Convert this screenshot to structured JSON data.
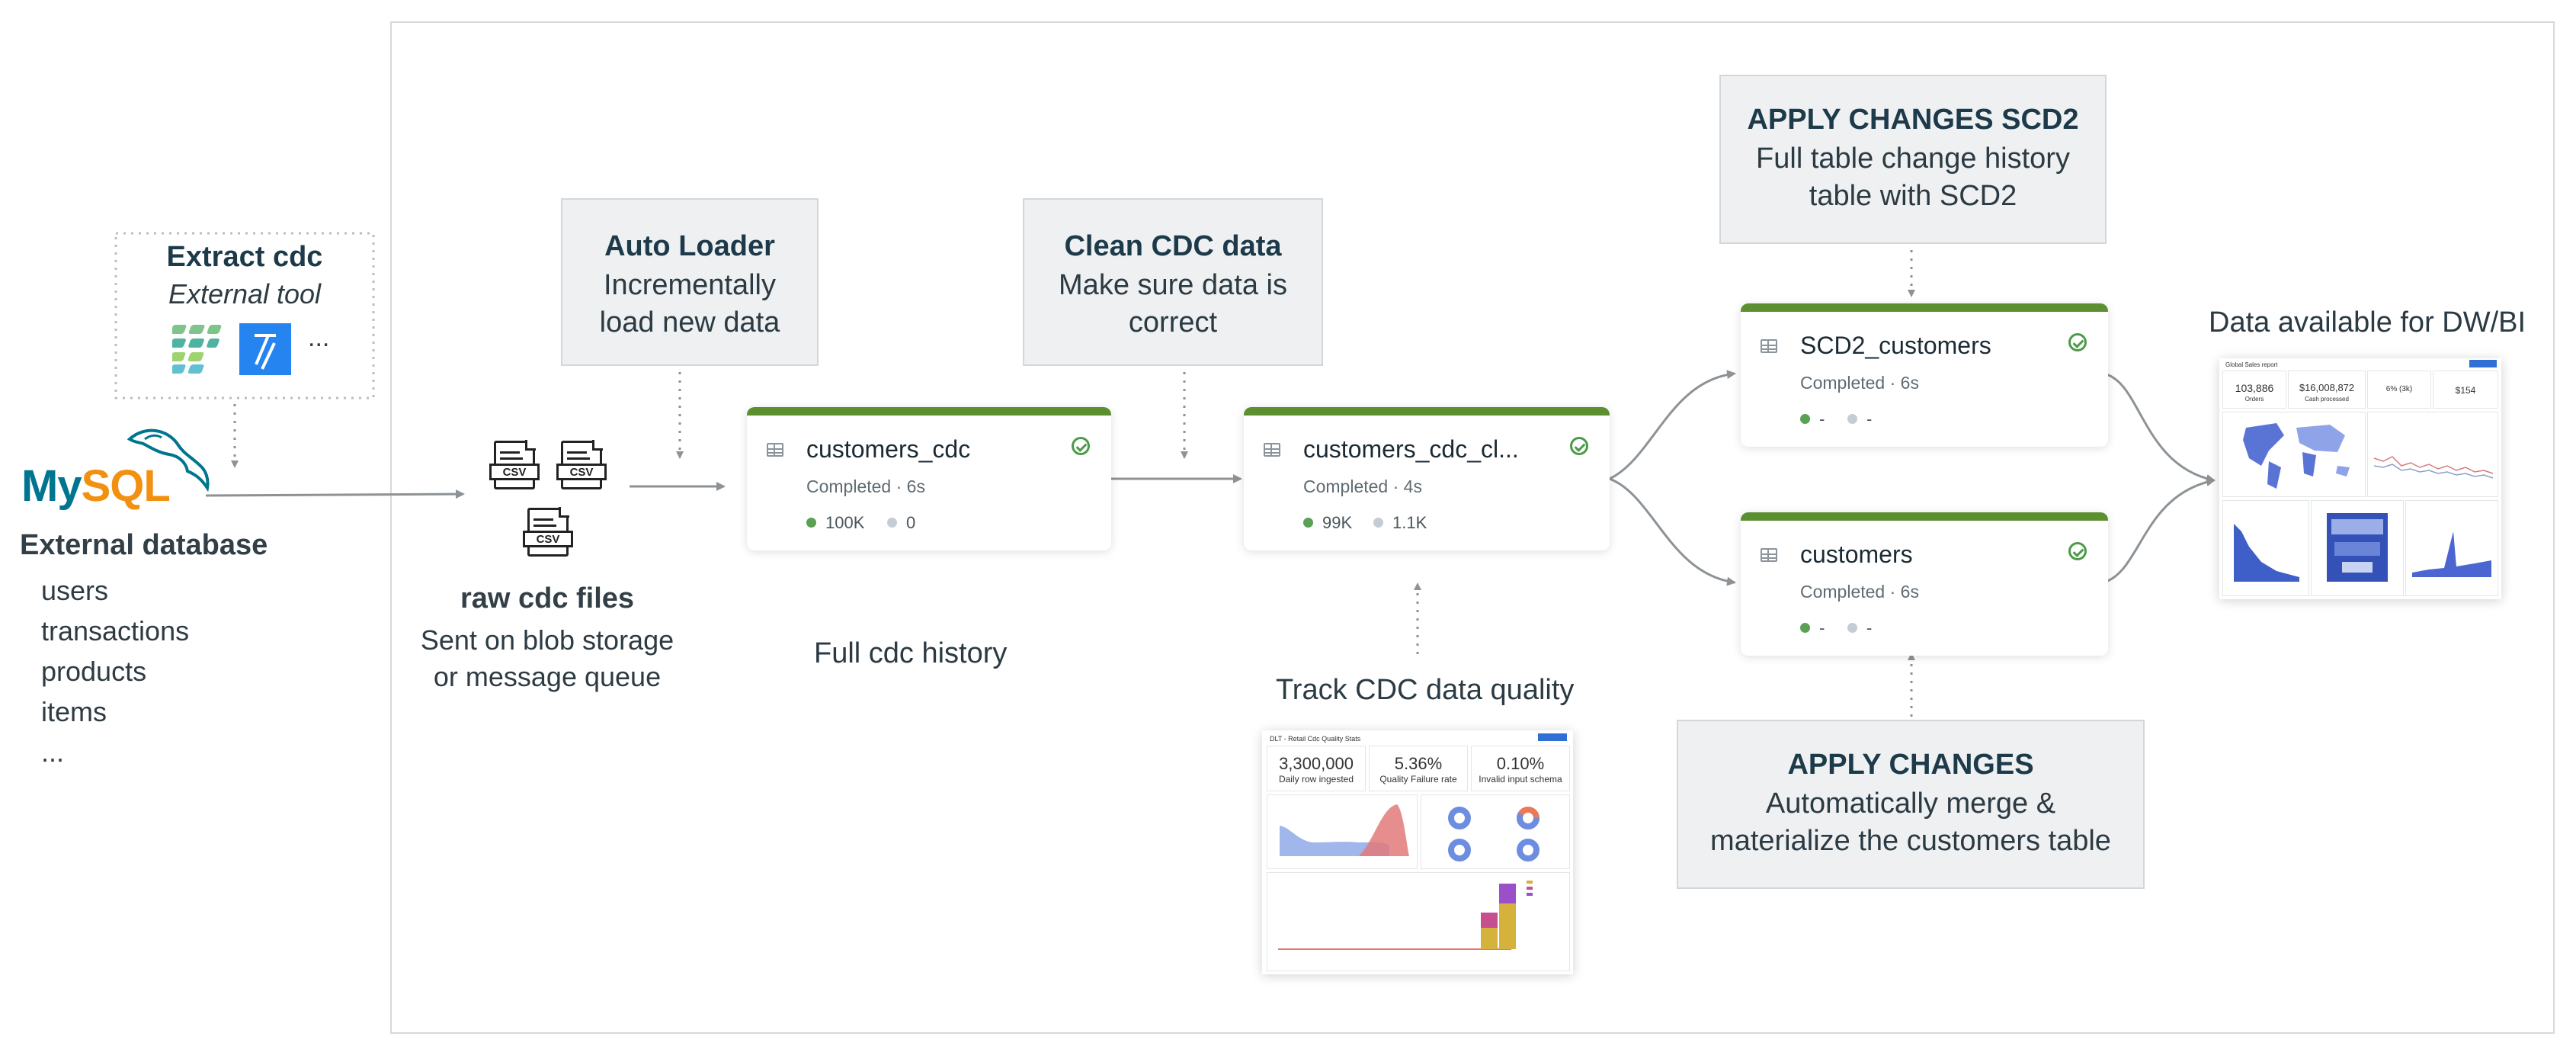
{
  "colors": {
    "accent_green": "#5b8f2f",
    "mysql_blue": "#00758f",
    "mysql_orange": "#f29111",
    "box_fill": "#eef0f1",
    "heading": "#1d3a4a"
  },
  "source": {
    "mysql_logo_text_my": "My",
    "mysql_logo_text_sql": "SQL",
    "title": "External database",
    "tables": [
      "users",
      "transactions",
      "products",
      "items",
      "..."
    ]
  },
  "extract": {
    "title": "Extract cdc",
    "subtitle": "External tool",
    "ellipsis": "..."
  },
  "raw_files": {
    "csv_label": "CSV",
    "title": "raw cdc files",
    "line1": "Sent on blob storage",
    "line2": "or message queue"
  },
  "auto_loader": {
    "title": "Auto Loader",
    "line1": "Incrementally",
    "line2": "load new data"
  },
  "clean_cdc": {
    "title": "Clean CDC data",
    "line1": "Make sure data is",
    "line2": "correct"
  },
  "apply_scd2": {
    "title": "APPLY CHANGES SCD2",
    "line1": "Full table change history",
    "line2": "table with SCD2"
  },
  "apply_changes": {
    "title": "APPLY CHANGES",
    "line1": "Automatically merge &",
    "line2": "materialize the customers table"
  },
  "nodes": {
    "customers_cdc": {
      "name": "customers_cdc",
      "status": "Completed · 6s",
      "metric_ok": "100K",
      "metric_drop": "0"
    },
    "customers_cdc_clean": {
      "name": "customers_cdc_cl...",
      "status": "Completed · 4s",
      "metric_ok": "99K",
      "metric_drop": "1.1K"
    },
    "scd2_customers": {
      "name": "SCD2_customers",
      "status": "Completed · 6s",
      "metric_ok": "-",
      "metric_drop": "-"
    },
    "customers": {
      "name": "customers",
      "status": "Completed · 6s",
      "metric_ok": "-",
      "metric_drop": "-"
    }
  },
  "captions": {
    "full_history": "Full cdc history",
    "track_quality": "Track CDC data quality",
    "dw_bi": "Data available for DW/BI"
  },
  "quality_dashboard": {
    "title": "DLT - Retail Cdc Quality Stats",
    "kpis": [
      {
        "value": "3,300,000",
        "label": "Daily row ingested"
      },
      {
        "value": "5.36%",
        "label": "Quality Failure rate"
      },
      {
        "value": "0.10%",
        "label": "Invalid input schema"
      }
    ]
  },
  "sales_dashboard": {
    "title": "Global Sales report",
    "kpis": [
      {
        "value": "103,886",
        "label": "Orders"
      },
      {
        "value": "$16,008,872",
        "label": "Cash processed"
      },
      {
        "value": "6% (3k)",
        "label": ""
      },
      {
        "value": "$154",
        "label": ""
      }
    ]
  }
}
